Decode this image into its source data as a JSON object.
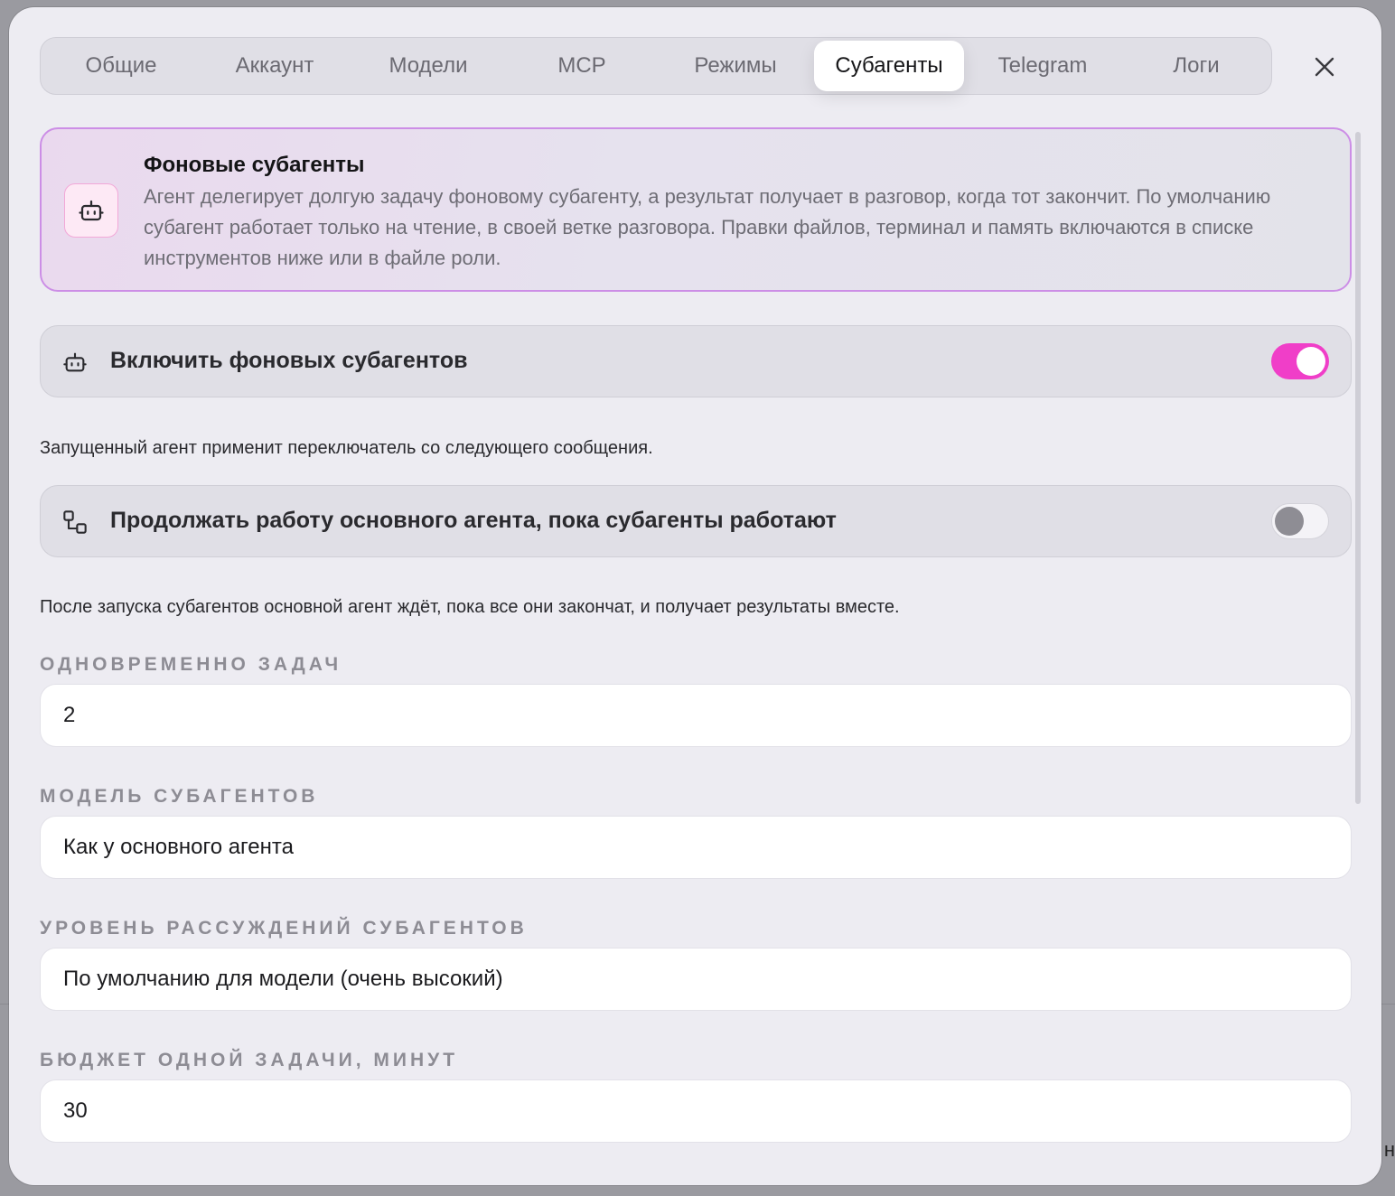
{
  "tabs": [
    {
      "label": "Общие",
      "active": false
    },
    {
      "label": "Аккаунт",
      "active": false
    },
    {
      "label": "Модели",
      "active": false
    },
    {
      "label": "MCP",
      "active": false
    },
    {
      "label": "Режимы",
      "active": false
    },
    {
      "label": "Субагенты",
      "active": true
    },
    {
      "label": "Telegram",
      "active": false
    },
    {
      "label": "Логи",
      "active": false
    }
  ],
  "close_icon": "close-icon",
  "info_card": {
    "icon": "robot-icon",
    "title": "Фоновые субагенты",
    "text": "Агент делегирует долгую задачу фоновому субагенту, а результат получает в разговор, когда тот закончит. По умолчанию субагент работает только на чтение, в своей ветке разговора. Правки файлов, терминал и память включаются в списке инструментов ниже или в файле роли.",
    "accent_color": "#cc8ee6"
  },
  "enable_row": {
    "icon": "robot-icon",
    "label": "Включить фоновых субагентов",
    "enabled": true,
    "hint": "Запущенный агент применит переключатель со следующего сообщения."
  },
  "continue_row": {
    "icon": "flow-icon",
    "label": "Продолжать работу основного агента, пока субагенты работают",
    "enabled": false,
    "hint": "После запуска субагентов основной агент ждёт, пока все они закончат, и получает результаты вместе."
  },
  "fields": {
    "concurrent": {
      "label": "ОДНОВРЕМЕННО ЗАДАЧ",
      "value": "2"
    },
    "model": {
      "label": "МОДЕЛЬ СУБАГЕНТОВ",
      "value": "Как у основного агента"
    },
    "reasoning": {
      "label": "УРОВЕНЬ РАССУЖДЕНИЙ СУБАГЕНТОВ",
      "value": "По умолчанию для модели (очень высокий)"
    },
    "budget": {
      "label": "БЮДЖЕТ ОДНОЙ ЗАДАЧИ, МИНУТ",
      "value": "30"
    }
  },
  "edge_text": "н",
  "colors": {
    "toggle_on": "#f03ec8",
    "modal_bg": "#edecf2"
  }
}
